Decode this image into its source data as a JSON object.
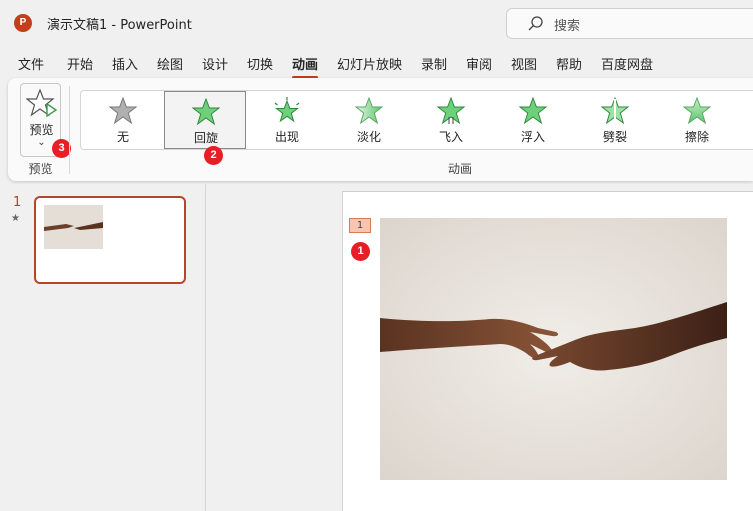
{
  "app": {
    "logo_letter": "P",
    "doc_title": "演示文稿1  -  PowerPoint"
  },
  "search": {
    "placeholder": "搜索"
  },
  "tabs": [
    {
      "label": "文件"
    },
    {
      "label": "开始"
    },
    {
      "label": "插入"
    },
    {
      "label": "绘图"
    },
    {
      "label": "设计"
    },
    {
      "label": "切换"
    },
    {
      "label": "动画",
      "active": true
    },
    {
      "label": "幻灯片放映"
    },
    {
      "label": "录制"
    },
    {
      "label": "审阅"
    },
    {
      "label": "视图"
    },
    {
      "label": "帮助"
    },
    {
      "label": "百度网盘"
    }
  ],
  "ribbon": {
    "preview": {
      "label": "预览",
      "caret": "⌄",
      "group_label": "预览",
      "badge": "3"
    },
    "animations": [
      {
        "label": "无",
        "icon": "star-none-icon"
      },
      {
        "label": "回旋",
        "icon": "star-swivel-icon",
        "selected": true,
        "badge": "2"
      },
      {
        "label": "出现",
        "icon": "star-appear-icon"
      },
      {
        "label": "淡化",
        "icon": "star-fade-icon"
      },
      {
        "label": "飞入",
        "icon": "star-fly-in-icon"
      },
      {
        "label": "浮入",
        "icon": "star-float-in-icon"
      },
      {
        "label": "劈裂",
        "icon": "star-split-icon"
      },
      {
        "label": "擦除",
        "icon": "star-wipe-icon"
      }
    ],
    "group_label": "动画"
  },
  "thumbnails": [
    {
      "number": "1",
      "star": "★"
    }
  ],
  "slide": {
    "animation_tag": "1",
    "badge": "1"
  },
  "colors": {
    "accent": "#c43e1c",
    "badge": "#e81e25",
    "star_green": "#5cc46a",
    "star_gray": "#a8a8a8"
  }
}
